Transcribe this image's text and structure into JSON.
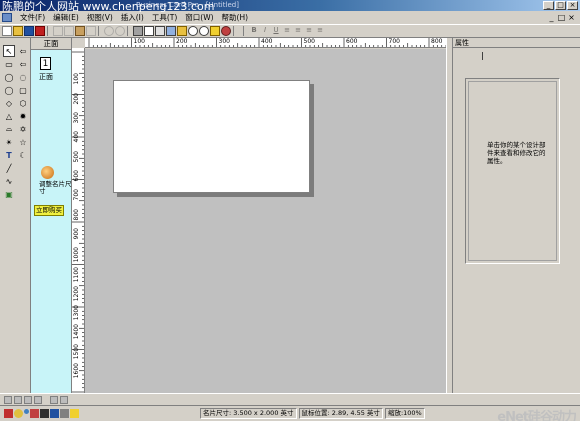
{
  "title_bar": {
    "watermark": "陈鹏的个人网站 www.chenpeng123.com",
    "subtitle": "Business Card Pro - [Untitled]",
    "controls": [
      "_",
      "□",
      "×"
    ]
  },
  "menu": {
    "items": [
      "文件(F)",
      "编辑(E)",
      "视图(V)",
      "插入(I)",
      "工具(T)",
      "窗口(W)",
      "帮助(H)"
    ],
    "window_controls": [
      "_",
      "□",
      "×"
    ]
  },
  "toolbar": {
    "font_buttons": [
      "B",
      "I",
      "U",
      "≡",
      "≡",
      "≡",
      "≡"
    ]
  },
  "tools": {
    "items": [
      {
        "name": "select-arrow-icon",
        "glyph": "↖"
      },
      {
        "name": "rotate-arrow-icon",
        "glyph": "⇦"
      },
      {
        "name": "rect-icon",
        "glyph": "▭"
      },
      {
        "name": "arrow-shape-icon",
        "glyph": "⇦"
      },
      {
        "name": "ellipse-icon",
        "glyph": "◯"
      },
      {
        "name": "callout-icon",
        "glyph": "◌"
      },
      {
        "name": "ellipse2-icon",
        "glyph": "◯"
      },
      {
        "name": "rounded-rect-icon",
        "glyph": "▢"
      },
      {
        "name": "diamond-icon",
        "glyph": "◇"
      },
      {
        "name": "hexagon-icon",
        "glyph": "⬡"
      },
      {
        "name": "triangle-icon",
        "glyph": "△"
      },
      {
        "name": "gear-shape-icon",
        "glyph": "✹"
      },
      {
        "name": "leaf-icon",
        "glyph": "⌓"
      },
      {
        "name": "star6-icon",
        "glyph": "✡"
      },
      {
        "name": "star5-icon",
        "glyph": "☆"
      },
      {
        "name": "star8-icon",
        "glyph": "✴"
      },
      {
        "name": "text-icon",
        "glyph": "T"
      },
      {
        "name": "moon-icon",
        "glyph": "☾"
      },
      {
        "name": "line-icon",
        "glyph": "╱"
      },
      {
        "name": "curve-icon",
        "glyph": "∿"
      },
      {
        "name": "image-icon",
        "glyph": "▣"
      }
    ]
  },
  "pages": {
    "header": "正面",
    "page_number": "1",
    "page_label": "正面",
    "resize_label": "调整名片尺寸",
    "buy_button": "立即购买"
  },
  "ruler": {
    "h_labels": [
      "100",
      "200",
      "300",
      "400",
      "500",
      "600",
      "700",
      "800",
      "900",
      "1000",
      "1100",
      "1200",
      "1300"
    ],
    "v_labels": [
      "100",
      "200",
      "300",
      "400",
      "500",
      "600",
      "700",
      "800",
      "900",
      "1000",
      "1100",
      "1200",
      "1300",
      "1400",
      "1500",
      "1600",
      "1700",
      "1800"
    ]
  },
  "properties": {
    "header": "属性",
    "hint": "单击你的某个设计部件来查看和修改它的属性。"
  },
  "status": {
    "card_size": "名片尺寸: 3.500 x 2.000 英寸",
    "position": "鼠标位置: 2.89, 4.55 英寸",
    "zoom": "缩放:100%",
    "brand": "eNet硅谷动力"
  },
  "colors": {
    "title_gradient_start": "#0a246a",
    "page_strip": "#c8f4f8",
    "canvas": "#c0c0c0",
    "buy_button": "#f0f040"
  }
}
